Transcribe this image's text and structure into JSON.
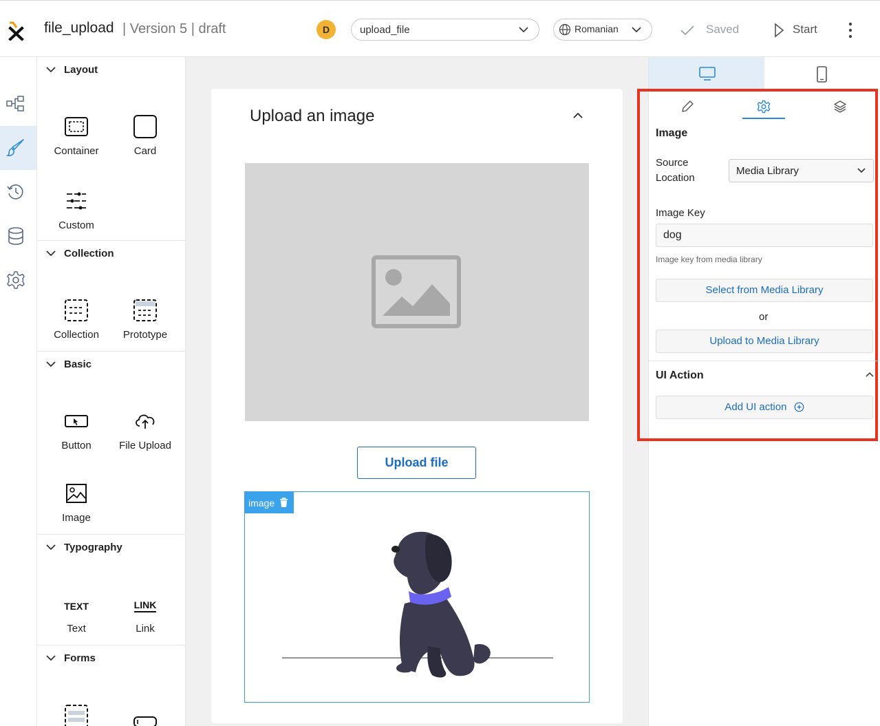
{
  "header": {
    "app_name": "file_upload",
    "version": "| Version 5 | draft",
    "avatar_initial": "D",
    "process_select": "upload_file",
    "language_select": "Romanian",
    "saved_label": "Saved",
    "start_label": "Start"
  },
  "rail": [
    "flow-icon",
    "brush-icon",
    "history-icon",
    "database-icon",
    "gear-icon"
  ],
  "palette": {
    "layout": {
      "title": "Layout",
      "items": [
        "Container",
        "Card",
        "Custom"
      ]
    },
    "collection": {
      "title": "Collection",
      "items": [
        "Collection",
        "Prototype"
      ]
    },
    "basic": {
      "title": "Basic",
      "items": [
        "Button",
        "File Upload",
        "Image"
      ]
    },
    "typography": {
      "title": "Typography",
      "items": [
        "Text",
        "Link"
      ],
      "text_glyph": "TEXT",
      "link_glyph": "LINK"
    },
    "forms": {
      "title": "Forms"
    }
  },
  "canvas": {
    "card_title": "Upload an image",
    "upload_button": "Upload file",
    "image_tag": "image"
  },
  "props": {
    "section_title": "Image",
    "source_location_label": "Source Location",
    "source_location_value": "Media Library",
    "image_key_label": "Image Key",
    "image_key_value": "dog",
    "image_key_hint": "Image key from media library",
    "select_button": "Select from Media Library",
    "or_label": "or",
    "upload_button": "Upload to Media Library",
    "ui_action_title": "UI Action",
    "add_ui_action": "Add UI action"
  },
  "colors": {
    "accent": "#1a6cc4",
    "highlight": "#e8331f",
    "avatar": "#f2b233",
    "dog_collar": "#6a63f0"
  }
}
